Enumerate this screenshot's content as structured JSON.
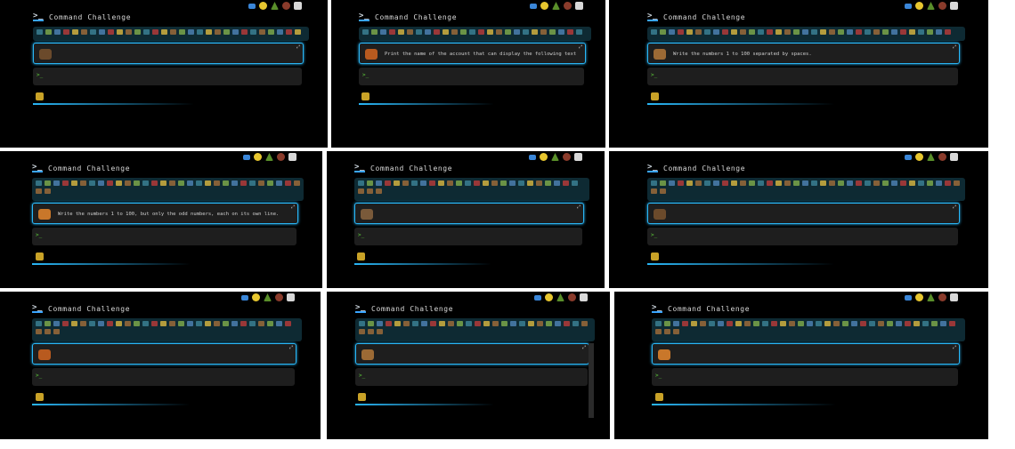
{
  "app": {
    "title": "Command Challenge"
  },
  "panels": [
    {
      "card_text": "",
      "status": "",
      "out": ""
    },
    {
      "card_text": "Print the name of the account that can display the following text",
      "status": "",
      "out": ""
    },
    {
      "card_text": "Write the numbers 1 to 100 separated by spaces.",
      "status": "",
      "out": ""
    },
    {
      "card_text": "Write the numbers 1 to 100, but only the odd numbers, each on its own line.",
      "status": "",
      "out": ""
    },
    {
      "card_text": "",
      "status": "",
      "out": ""
    },
    {
      "card_text": "",
      "status": "",
      "out": ""
    },
    {
      "card_text": "",
      "status": "",
      "out": ""
    },
    {
      "card_text": "",
      "status": "",
      "out": ""
    },
    {
      "card_text": "",
      "status": "",
      "out": ""
    }
  ],
  "icons": {
    "prompt": "terminal-prompt-icon",
    "pin": "pin-icon",
    "status": "trophy-icon"
  },
  "colors": {
    "bg": "#000000",
    "card": "#1e1e1e",
    "accent": "#29b6f6",
    "green": "#5ecb3b"
  }
}
